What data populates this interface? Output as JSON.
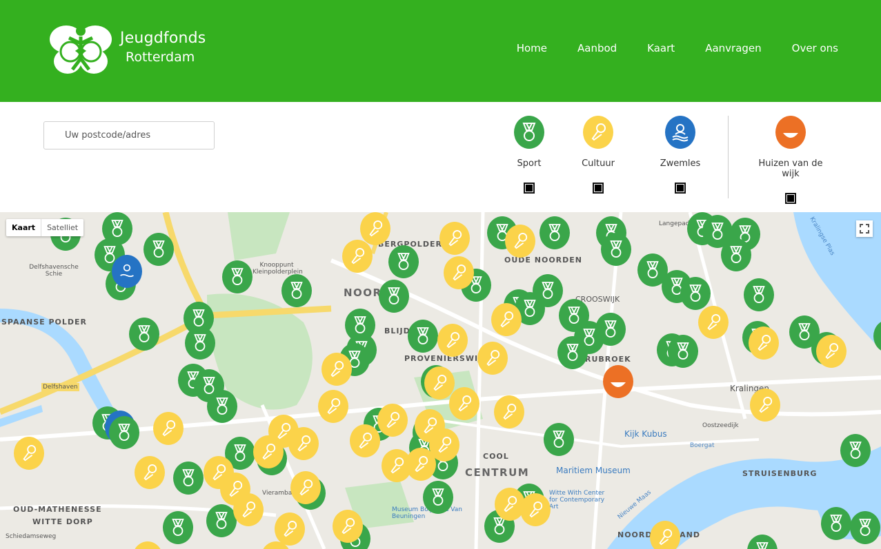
{
  "header": {
    "logo_line1": "Jeugdfonds",
    "logo_line2": "Rotterdam",
    "nav": [
      "Home",
      "Aanbod",
      "Kaart",
      "Aanvragen",
      "Over ons"
    ]
  },
  "search": {
    "placeholder": "Uw postcode/adres"
  },
  "filters": [
    {
      "label": "Sport",
      "icon": "medal-icon",
      "color": "#3aa64a",
      "checked": true
    },
    {
      "label": "Cultuur",
      "icon": "microphone-icon",
      "color": "#fbd34a",
      "checked": true
    },
    {
      "label": "Zwemles",
      "icon": "swimmer-icon",
      "color": "#2573c4",
      "checked": true
    },
    {
      "label": "Huizen van de wijk",
      "icon": "smile-icon",
      "color": "#ec7025",
      "checked": true
    }
  ],
  "map": {
    "toggle": [
      "Kaart",
      "Satelliet"
    ],
    "labels": [
      "SPAANSE POLDER",
      "BERGPOLDER",
      "OUDE NOORDEN",
      "NOORD",
      "BLIJDORP",
      "PROVENIERSWIJK",
      "CROOSWIJK",
      "RUBROEK",
      "Kralingen",
      "COOL",
      "CENTRUM",
      "STRUISENBURG",
      "OUD-MATHENESSE",
      "WITTE DORP",
      "NOORDEREILAND",
      "Kijk Kubus",
      "Maritiem Museum",
      "Langepad",
      "Kralingse Plas",
      "Delfshavensche Schie",
      "Knooppunt Kleinpolderplein",
      "Oostzeedijk",
      "Boergat",
      "Nieuwe Maas",
      "Schiedamseweg",
      "Vierambachtsstraat",
      "Museum Boijmans Van Beuningen",
      "Witte With Center for Contemporary Art",
      "Delfshaven"
    ],
    "colors": {
      "sport": "#3aa64a",
      "cultuur": "#fbd34a",
      "zwem": "#2573c4",
      "huis": "#ec7025"
    }
  }
}
